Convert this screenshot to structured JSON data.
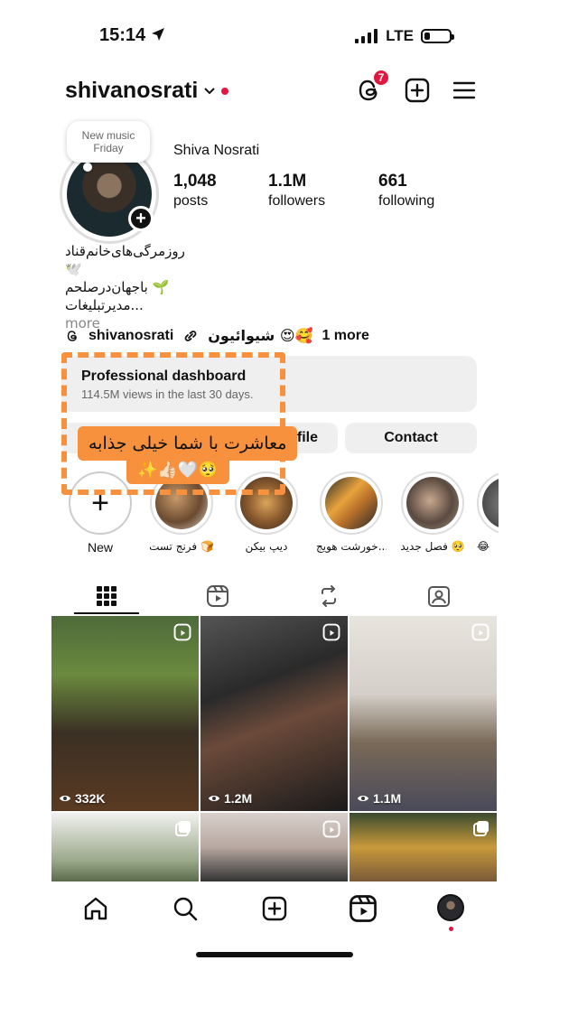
{
  "status_bar": {
    "time": "15:14",
    "network": "LTE"
  },
  "header": {
    "username": "shivanosrati",
    "notification_count": "7"
  },
  "profile": {
    "note_text": "New music Friday",
    "display_name": "Shiva Nosrati",
    "stats": [
      {
        "value": "1,048",
        "label": "posts"
      },
      {
        "value": "1.1M",
        "label": "followers"
      },
      {
        "value": "661",
        "label": "following"
      }
    ],
    "bio_lines": [
      "روزمرگی‌های‌خانم‌قناد",
      "🕊️",
      "باجهان‌درصلحم 🌱",
      "مدیرتبلیغات..."
    ],
    "bio_more": "more",
    "threads_handle": "shivanosrati",
    "link_text": "شیوائیون 😍🥰",
    "more_links": "1 more"
  },
  "dashboard": {
    "title": "Professional dashboard",
    "subtitle": "114.5M views in the last 30 days."
  },
  "actions": {
    "edit_profile_partial": "ofile",
    "contact": "Contact"
  },
  "sticker": {
    "line1": "معاشرت با شما خیلی جذابه",
    "line2": "✨👍🏻🤍🥺"
  },
  "highlights": [
    {
      "label": "New"
    },
    {
      "label": "فرنج تست 🍞"
    },
    {
      "label": "دیپ بیکن"
    },
    {
      "label": "خورشت هویج..."
    },
    {
      "label": "فصل جدید 🥺"
    },
    {
      "label": "😂"
    }
  ],
  "tabs": [
    "grid",
    "reels",
    "reposts",
    "tagged"
  ],
  "posts": [
    {
      "views": "332K"
    },
    {
      "views": "1.2M"
    },
    {
      "views": "1.1M"
    },
    {
      "views": ""
    },
    {
      "views": ""
    },
    {
      "views": ""
    }
  ],
  "colors": {
    "accent_orange": "#f7913d",
    "notification_red": "#e1173f"
  },
  "icons": [
    "threads-icon",
    "add-post-icon",
    "menu-icon",
    "home-icon",
    "search-icon",
    "create-icon",
    "reels-icon",
    "profile-avatar-icon"
  ]
}
